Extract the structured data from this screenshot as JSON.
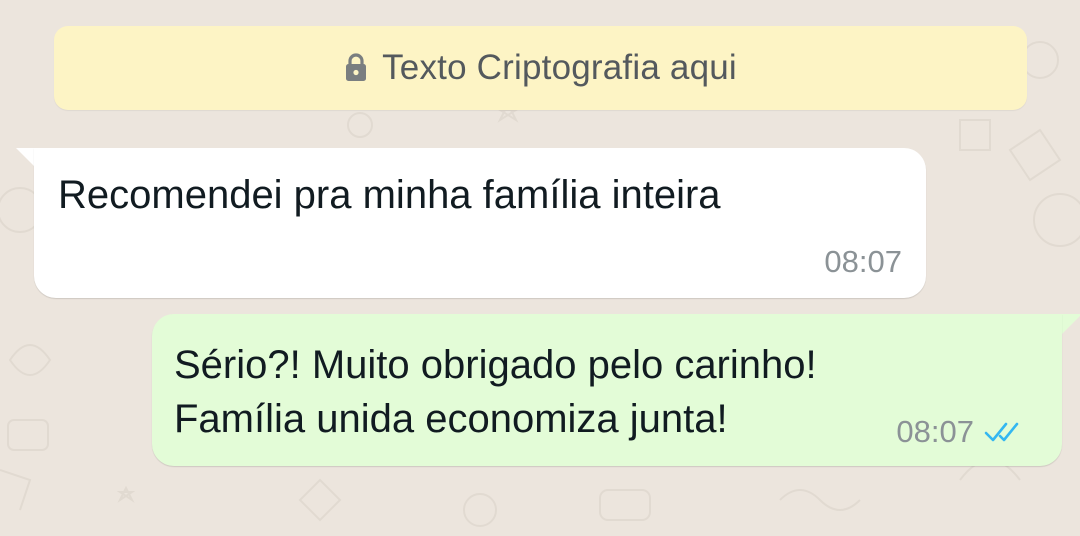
{
  "banner": {
    "text": "Texto Criptografia aqui",
    "icon": "lock-icon"
  },
  "messages": [
    {
      "direction": "incoming",
      "lines": [
        "Recomendei pra minha família inteira"
      ],
      "time": "08:07"
    },
    {
      "direction": "outgoing",
      "lines": [
        "Sério?! Muito obrigado pelo carinho!",
        "Família unida economiza junta!"
      ],
      "time": "08:07",
      "status": "read",
      "status_icon": "double-check-icon"
    }
  ],
  "colors": {
    "background": "#ece5dd",
    "banner": "#fdf4c5",
    "incoming_bubble": "#ffffff",
    "outgoing_bubble": "#e3fcd7",
    "read_ticks": "#34b7f1",
    "timestamp": "#8b9296"
  }
}
